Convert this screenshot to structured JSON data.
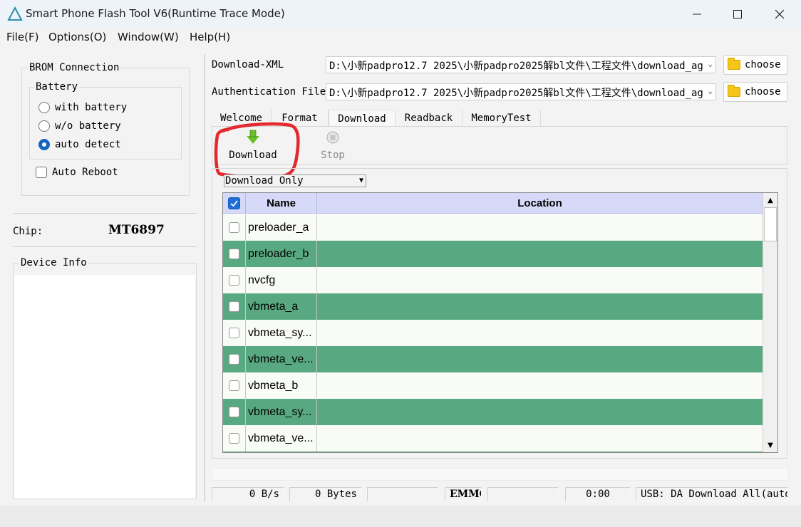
{
  "window": {
    "title": "Smart Phone Flash Tool V6(Runtime Trace Mode)"
  },
  "menu": {
    "items": [
      "File(F)",
      "Options(O)",
      "Window(W)",
      "Help(H)"
    ]
  },
  "left": {
    "brom_title": "BROM Connection",
    "battery_title": "Battery",
    "battery_options": [
      {
        "label": "with battery",
        "checked": false
      },
      {
        "label": "w/o battery",
        "checked": false
      },
      {
        "label": "auto detect",
        "checked": true
      }
    ],
    "auto_reboot_label": "Auto Reboot",
    "chip_label": "Chip:",
    "chip_value": "MT6897",
    "device_info_title": "Device Info"
  },
  "files": {
    "download_xml_label": "Download-XML",
    "download_xml_value": "D:\\小新padpro12.7 2025\\小新padpro2025解bl文件\\工程文件\\download_ag",
    "auth_label": "Authentication File",
    "auth_value": "D:\\小新padpro12.7 2025\\小新padpro2025解bl文件\\工程文件\\download_ag",
    "choose_label": "choose"
  },
  "tabs": {
    "items": [
      "Welcome",
      "Format",
      "Download",
      "Readback",
      "MemoryTest"
    ],
    "active": "Download"
  },
  "toolbar": {
    "download_label": "Download",
    "stop_label": "Stop"
  },
  "download": {
    "mode": "Download Only",
    "columns": [
      "Name",
      "Location"
    ],
    "rows": [
      {
        "name": "preloader_a",
        "location": ""
      },
      {
        "name": "preloader_b",
        "location": ""
      },
      {
        "name": "nvcfg",
        "location": ""
      },
      {
        "name": "vbmeta_a",
        "location": ""
      },
      {
        "name": "vbmeta_sy...",
        "location": ""
      },
      {
        "name": "vbmeta_ve...",
        "location": ""
      },
      {
        "name": "vbmeta_b",
        "location": ""
      },
      {
        "name": "vbmeta_sy...",
        "location": ""
      },
      {
        "name": "vbmeta_ve...",
        "location": ""
      }
    ]
  },
  "status": {
    "speed": "0 B/s",
    "bytes": "0 Bytes",
    "storage": "EMMC",
    "time": "0:00",
    "usb": "USB: DA Download All(auto"
  },
  "colors": {
    "row_highlight": "#58a981",
    "header_bg": "#d6d9f7",
    "accent": "#1565c0"
  }
}
